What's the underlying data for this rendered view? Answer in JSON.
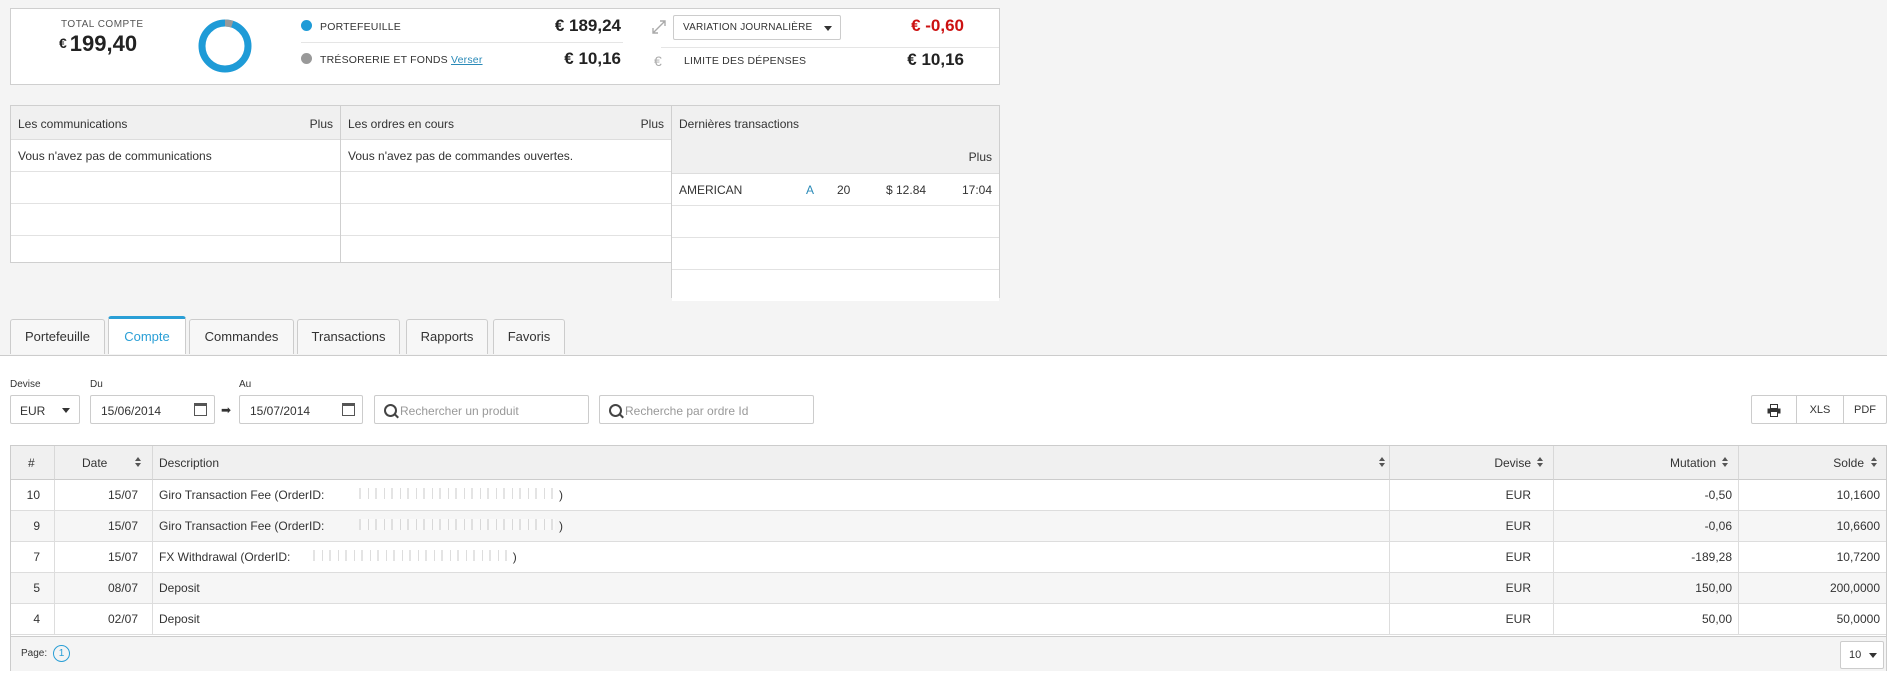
{
  "summary": {
    "total_label": "TOTAL COMPTE",
    "total_currency": "€",
    "total_value": "199,40",
    "rows": [
      {
        "label": "PORTEFEUILLE",
        "link": "",
        "value": "€ 189,24",
        "dot_color": "#1e9bd7"
      },
      {
        "label": "TRÉSORERIE ET FONDS",
        "link": "Verser",
        "value": "€ 10,16",
        "dot_color": "#999999"
      }
    ],
    "variation_select": "VARIATION JOURNALIÈRE",
    "variation_value": "€ -0,60",
    "variation_color": "#cc1111",
    "limit_label": "LIMITE DES DÉPENSES",
    "limit_value": "€ 10,16",
    "euro_icon": "€",
    "donut": {
      "portefeuille_share": 0.949,
      "tresorerie_share": 0.051
    }
  },
  "communications": {
    "title": "Les communications",
    "more": "Plus",
    "empty": "Vous n'avez pas de communications"
  },
  "orders": {
    "title": "Les ordres en cours",
    "more": "Plus",
    "empty": "Vous n'avez pas de commandes ouvertes."
  },
  "last_transactions": {
    "title": "Dernières transactions",
    "more": "Plus",
    "rows": [
      {
        "product": "AMERICAN",
        "side": "A",
        "qty": "20",
        "price": "$ 12.84",
        "time": "17:04"
      }
    ]
  },
  "tabs": [
    {
      "label": "Portefeuille",
      "active": false
    },
    {
      "label": "Compte",
      "active": true
    },
    {
      "label": "Commandes",
      "active": false
    },
    {
      "label": "Transactions",
      "active": false
    },
    {
      "label": "Rapports",
      "active": false
    },
    {
      "label": "Favoris",
      "active": false
    }
  ],
  "filters": {
    "devise_label": "Devise",
    "devise_value": "EUR",
    "from_label": "Du",
    "from_value": "15/06/2014",
    "to_label": "Au",
    "to_value": "15/07/2014",
    "search_product_placeholder": "Rechercher un produit",
    "search_order_placeholder": "Recherche par ordre Id"
  },
  "export": {
    "print_icon": "printer-icon",
    "xls": "XLS",
    "pdf": "PDF"
  },
  "grid": {
    "columns": [
      "#",
      "Date",
      "Description",
      "Devise",
      "Mutation",
      "Solde"
    ],
    "rows": [
      {
        "id": "10",
        "date": "15/07",
        "desc": "Giro Transaction Fee (OrderID:",
        "desc_end": ")",
        "devise": "EUR",
        "mutation": "-0,50",
        "solde": "10,1600"
      },
      {
        "id": "9",
        "date": "15/07",
        "desc": "Giro Transaction Fee (OrderID:",
        "desc_end": ")",
        "devise": "EUR",
        "mutation": "-0,06",
        "solde": "10,6600"
      },
      {
        "id": "7",
        "date": "15/07",
        "desc": "FX Withdrawal (OrderID:",
        "desc_end": ")",
        "devise": "EUR",
        "mutation": "-189,28",
        "solde": "10,7200"
      },
      {
        "id": "5",
        "date": "08/07",
        "desc": "Deposit",
        "desc_end": "",
        "devise": "EUR",
        "mutation": "150,00",
        "solde": "200,0000"
      },
      {
        "id": "4",
        "date": "02/07",
        "desc": "Deposit",
        "desc_end": "",
        "devise": "EUR",
        "mutation": "50,00",
        "solde": "50,0000"
      }
    ],
    "page_label": "Page:",
    "page_number": "1",
    "per_page": "10"
  }
}
